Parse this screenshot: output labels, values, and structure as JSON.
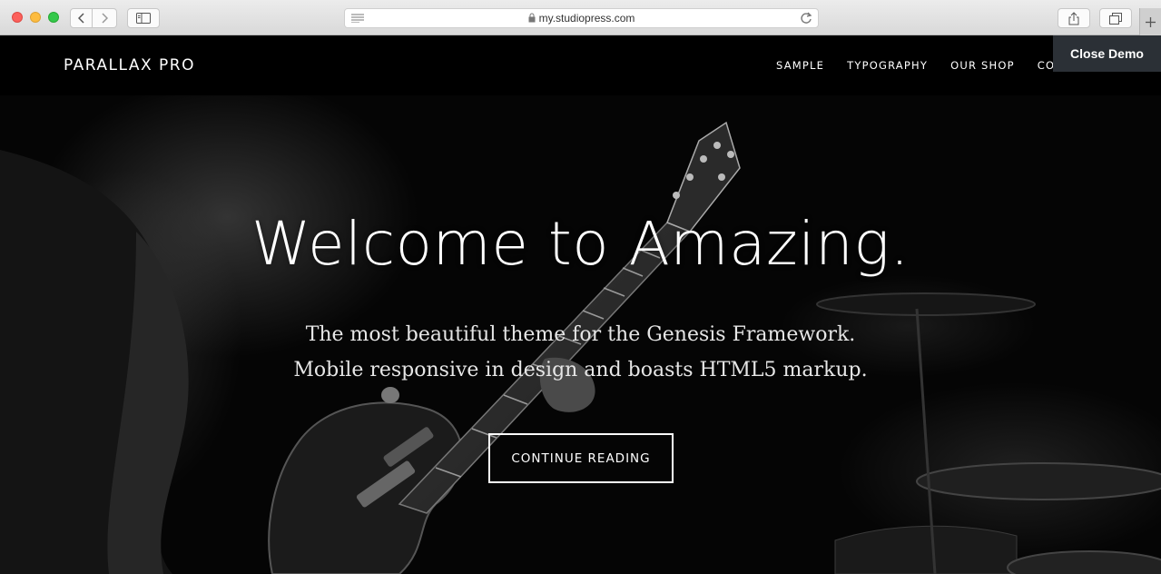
{
  "browser": {
    "url": "my.studiopress.com",
    "icons": {
      "back": "chevron-left-icon",
      "forward": "chevron-right-icon",
      "sidebar": "sidebar-icon",
      "reader": "reader-icon",
      "lock": "lock-icon",
      "reload": "reload-icon",
      "share": "share-icon",
      "tabs": "tabs-icon",
      "new_tab": "plus-icon"
    }
  },
  "site": {
    "title": "PARALLAX PRO",
    "nav": [
      {
        "label": "SAMPLE"
      },
      {
        "label": "TYPOGRAPHY"
      },
      {
        "label": "OUR SHOP"
      },
      {
        "label": "CONTACT"
      }
    ],
    "close_demo": "Close Demo"
  },
  "hero": {
    "title": "Welcome to Amazing.",
    "subtitle_line1": "The most beautiful theme for the Genesis Framework.",
    "subtitle_line2": "Mobile responsive in design and boasts HTML5 markup.",
    "cta_label": "CONTINUE READING"
  },
  "colors": {
    "header_bg": "#000000",
    "close_demo_bg": "#2b3036",
    "text": "#ffffff"
  }
}
